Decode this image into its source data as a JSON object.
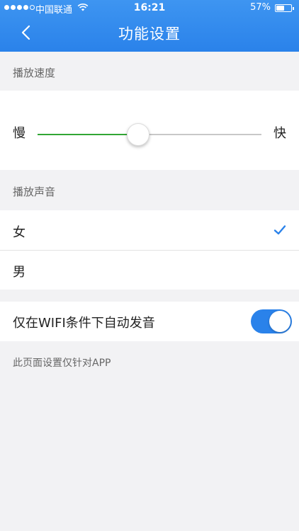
{
  "status_bar": {
    "carrier": "中国联通",
    "time": "16:21",
    "battery_percent": "57%",
    "battery_level": 0.57,
    "signal_bars": 4,
    "signal_max": 5
  },
  "nav": {
    "back_icon": "chevron-left-icon",
    "title": "功能设置"
  },
  "speed": {
    "section_label": "播放速度",
    "slow_label": "慢",
    "fast_label": "快",
    "value": 0.45
  },
  "voice": {
    "section_label": "播放声音",
    "options": [
      {
        "label": "女",
        "selected": true
      },
      {
        "label": "男",
        "selected": false
      }
    ]
  },
  "wifi_only": {
    "label": "仅在WIFI条件下自动发音",
    "enabled": true
  },
  "footnote": "此页面设置仅针对APP",
  "colors": {
    "accent": "#2a82ea",
    "slider_fill": "#32a635",
    "background": "#f2f2f4"
  }
}
